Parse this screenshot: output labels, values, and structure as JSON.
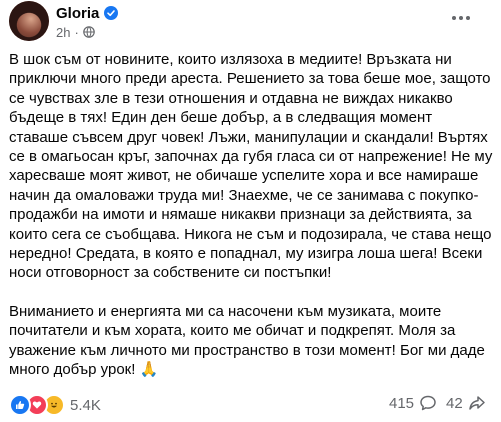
{
  "post": {
    "author": "Gloria",
    "time": "2h",
    "paragraphs": [
      "В шок съм от новините, които излязоха в медиите! Връзката ни приключи много преди ареста. Решението за това беше мое, защото се чувствах зле в тези отношения и отдавна не виждах никакво бъдеще в тях! Един ден беше добър, а в следващия момент ставаше съвсем друг човек! Лъжи, манипулации и скандали! Въртях се в омагьосан кръг, започнах да губя гласа си от напрежение! Не му харесваше моят живот, не обичаше успелите хора и все намираше начин да омаловажи труда ми! Знаехме, че се занимава с покупко-продажби на имоти и нямаше никакви признаци за действията, за които сега се съобщава. Никога не съм и подозирала, че става нещо нередно! Средата, в която е попаднал, му изигра лоша шега! Всеки носи отговорност за собствените си постъпки!",
      "Вниманието и енергията ми са насочени към музиката, моите почитатели и към хората, които ме обичат и подкрепят. Моля за уважение към личното ми пространство в този момент! Бог ми даде много добър урок!"
    ],
    "closing_emoji": "🙏"
  },
  "footer": {
    "reactions_count": "5.4K",
    "comments_count": "415",
    "shares_count": "42"
  },
  "colors": {
    "accent": "#1877f2",
    "muted": "#65676b",
    "love": "#f33e58",
    "haha": "#f7b928"
  }
}
